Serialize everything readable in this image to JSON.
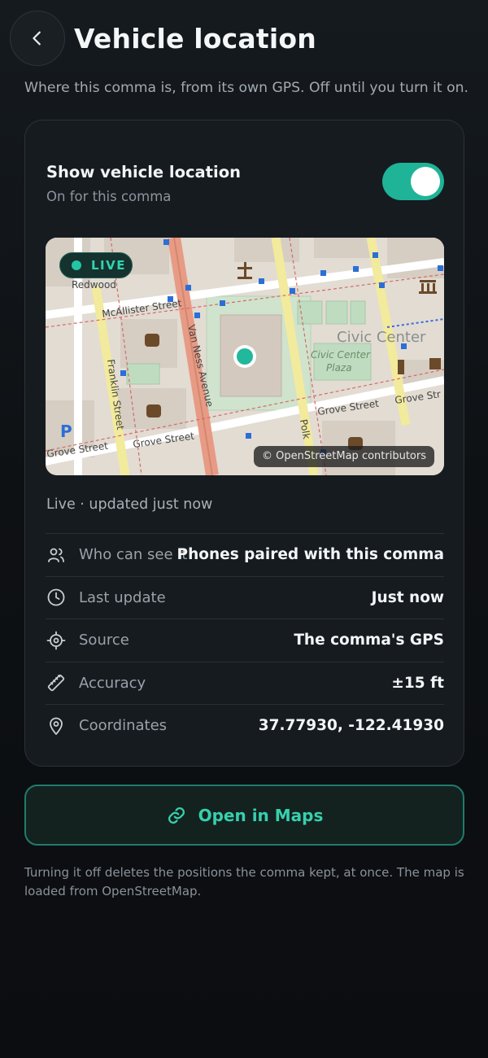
{
  "header": {
    "title": "Vehicle location"
  },
  "subtitle": "Where this comma is, from its own GPS. Off until you turn it on.",
  "card": {
    "toggle": {
      "title": "Show vehicle location",
      "subtitle": "On for this comma",
      "on": true,
      "color": "#1fb398"
    },
    "map": {
      "badge": "LIVE",
      "attribution": "© OpenStreetMap contributors",
      "labels": {
        "redwood": "Redwood",
        "mcallister": "McAllister Street",
        "van_ness": "Van Ness Avenue",
        "franklin": "Franklin Street",
        "grove_left": "Grove Street",
        "grove_mid": "Grove Street",
        "grove_right": "Grove Street",
        "grove_far": "Grove Str",
        "polk": "Polk",
        "civic_center": "Civic Center",
        "civic_plaza_1": "Civic Center",
        "civic_plaza_2": "Plaza",
        "poi_p": "P"
      }
    },
    "status": "Live · updated just now",
    "rows": [
      {
        "icon": "people-icon",
        "label": "Who can see it",
        "value": "Phones paired with this comma"
      },
      {
        "icon": "clock-icon",
        "label": "Last update",
        "value": "Just now"
      },
      {
        "icon": "target-icon",
        "label": "Source",
        "value": "The comma's GPS"
      },
      {
        "icon": "ruler-icon",
        "label": "Accuracy",
        "value": "±15 ft"
      },
      {
        "icon": "pin-icon",
        "label": "Coordinates",
        "value": "37.77930, -122.41930"
      }
    ]
  },
  "open_maps_button": {
    "label": "Open in Maps",
    "icon": "link-icon",
    "accent": "#37d0ae"
  },
  "footnote": "Turning it off deletes the positions the comma kept, at once. The map is loaded from OpenStreetMap."
}
